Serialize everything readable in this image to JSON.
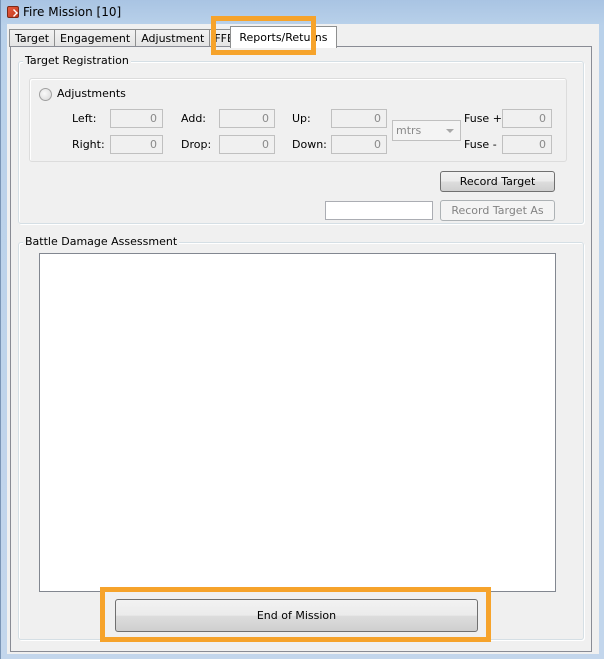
{
  "window": {
    "title": "Fire Mission [10]",
    "icon": "fire-mission-app-icon"
  },
  "tabs": [
    {
      "label": "Target",
      "active": false
    },
    {
      "label": "Engagement",
      "active": false
    },
    {
      "label": "Adjustment",
      "active": false
    },
    {
      "label": "FFE",
      "active": false
    },
    {
      "label": "Reports/Returns",
      "active": true
    }
  ],
  "target_registration": {
    "group_label": "Target Registration",
    "adjustments_label": "Adjustments",
    "adjustments_selected": false,
    "fields": {
      "left": {
        "label": "Left:",
        "value": "0"
      },
      "right": {
        "label": "Right:",
        "value": "0"
      },
      "add": {
        "label": "Add:",
        "value": "0"
      },
      "drop": {
        "label": "Drop:",
        "value": "0"
      },
      "up": {
        "label": "Up:",
        "value": "0"
      },
      "down": {
        "label": "Down:",
        "value": "0"
      },
      "fuse_plus": {
        "label": "Fuse +",
        "value": "0"
      },
      "fuse_minus": {
        "label": "Fuse -",
        "value": "0"
      }
    },
    "units": {
      "selected": "mtrs"
    },
    "record_target_label": "Record Target",
    "record_target_as_label": "Record Target As",
    "record_target_as_name": ""
  },
  "battle_damage_assessment": {
    "group_label": "Battle Damage Assessment",
    "text": ""
  },
  "end_of_mission_label": "End of Mission",
  "colors": {
    "highlight": "#f6a32b",
    "title_bar": "#b9d1ea"
  }
}
